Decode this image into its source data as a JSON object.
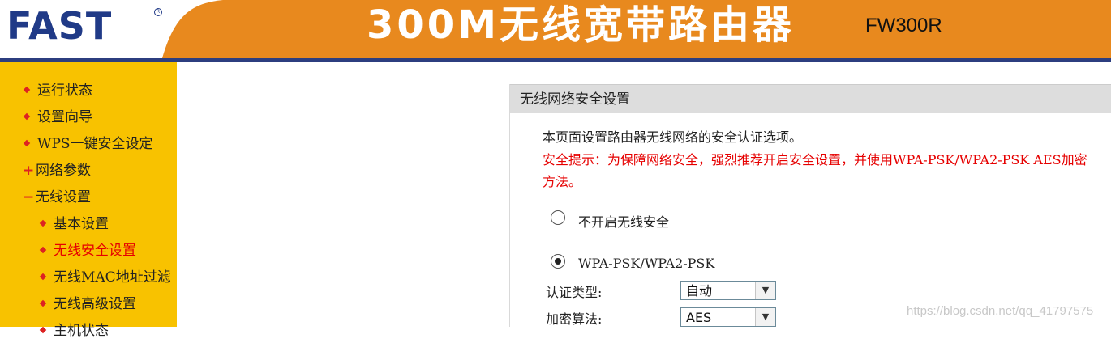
{
  "header": {
    "logo_text": "FAST",
    "logo_reg": "R",
    "product_title": "300M无线宽带路由器",
    "model": "FW300R",
    "colors": {
      "orange": "#e8891e",
      "stripe": "#2c3e7f",
      "logo": "#203a87"
    }
  },
  "sidebar": {
    "items": [
      {
        "label": "运行状态",
        "marker": "bullet"
      },
      {
        "label": "设置向导",
        "marker": "bullet"
      },
      {
        "label": "WPS一键安全设定",
        "marker": "bullet"
      },
      {
        "label": "网络参数",
        "marker": "+"
      },
      {
        "label": "无线设置",
        "marker": "−"
      },
      {
        "label": "基本设置",
        "marker": "bullet"
      },
      {
        "label": "无线安全设置",
        "marker": "bullet",
        "active": true
      },
      {
        "label": "无线MAC地址过滤",
        "marker": "bullet"
      },
      {
        "label": "无线高级设置",
        "marker": "bullet"
      },
      {
        "label": "主机状态",
        "marker": "bullet"
      }
    ]
  },
  "panel": {
    "title": "无线网络安全设置",
    "description": "本页面设置路由器无线网络的安全认证选项。",
    "warning": "安全提示：为保障网络安全，强烈推荐开启安全设置，并使用WPA-PSK/WPA2-PSK AES加密方法。",
    "options": [
      {
        "label": "不开启无线安全",
        "checked": false
      },
      {
        "label": "WPA-PSK/WPA2-PSK",
        "checked": true
      }
    ],
    "auth_type_label": "认证类型:",
    "auth_type_value": "自动",
    "encryption_label": "加密算法:",
    "encryption_value": "AES"
  },
  "watermark": "https://blog.csdn.net/qq_41797575"
}
